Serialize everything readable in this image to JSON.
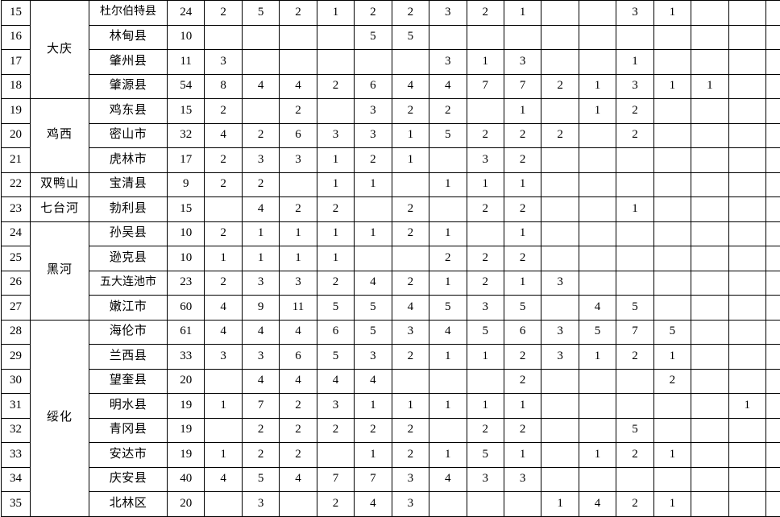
{
  "table": {
    "columns": {
      "index_header": "",
      "region_header": "",
      "county_header": "",
      "data_column_count": 17
    },
    "rows": [
      {
        "index": "15",
        "region": "大庆",
        "region_rowspan": 4,
        "county": "杜尔伯特县",
        "values": [
          "24",
          "2",
          "5",
          "2",
          "1",
          "2",
          "2",
          "3",
          "2",
          "1",
          "",
          "",
          "3",
          "1",
          "",
          "",
          ""
        ]
      },
      {
        "index": "16",
        "region": "",
        "county": "林甸县",
        "values": [
          "10",
          "",
          "",
          "",
          "",
          "5",
          "5",
          "",
          "",
          "",
          "",
          "",
          "",
          "",
          "",
          "",
          ""
        ]
      },
      {
        "index": "17",
        "region": "",
        "county": "肇州县",
        "values": [
          "11",
          "3",
          "",
          "",
          "",
          "",
          "",
          "3",
          "1",
          "3",
          "",
          "",
          "1",
          "",
          "",
          "",
          ""
        ]
      },
      {
        "index": "18",
        "region": "",
        "county": "肇源县",
        "values": [
          "54",
          "8",
          "4",
          "4",
          "2",
          "6",
          "4",
          "4",
          "7",
          "7",
          "2",
          "1",
          "3",
          "1",
          "1",
          "",
          ""
        ]
      },
      {
        "index": "19",
        "region": "鸡西",
        "region_rowspan": 3,
        "county": "鸡东县",
        "values": [
          "15",
          "2",
          "",
          "2",
          "",
          "3",
          "2",
          "2",
          "",
          "1",
          "",
          "1",
          "2",
          "",
          "",
          "",
          ""
        ]
      },
      {
        "index": "20",
        "region": "",
        "county": "密山市",
        "values": [
          "32",
          "4",
          "2",
          "6",
          "3",
          "3",
          "1",
          "5",
          "2",
          "2",
          "2",
          "",
          "2",
          "",
          "",
          "",
          ""
        ]
      },
      {
        "index": "21",
        "region": "",
        "county": "虎林市",
        "values": [
          "17",
          "2",
          "3",
          "3",
          "1",
          "2",
          "1",
          "",
          "3",
          "2",
          "",
          "",
          "",
          "",
          "",
          "",
          ""
        ]
      },
      {
        "index": "22",
        "region": "双鸭山",
        "region_rowspan": 1,
        "county": "宝清县",
        "values": [
          "9",
          "2",
          "2",
          "",
          "1",
          "1",
          "",
          "1",
          "1",
          "1",
          "",
          "",
          "",
          "",
          "",
          "",
          ""
        ]
      },
      {
        "index": "23",
        "region": "七台河",
        "region_rowspan": 1,
        "county": "勃利县",
        "values": [
          "15",
          "",
          "4",
          "2",
          "2",
          "",
          "2",
          "",
          "2",
          "2",
          "",
          "",
          "1",
          "",
          "",
          "",
          ""
        ]
      },
      {
        "index": "24",
        "region": "黑河",
        "region_rowspan": 4,
        "county": "孙吴县",
        "values": [
          "10",
          "2",
          "1",
          "1",
          "1",
          "1",
          "2",
          "1",
          "",
          "1",
          "",
          "",
          "",
          "",
          "",
          "",
          ""
        ]
      },
      {
        "index": "25",
        "region": "",
        "county": "逊克县",
        "values": [
          "10",
          "1",
          "1",
          "1",
          "1",
          "",
          "",
          "2",
          "2",
          "2",
          "",
          "",
          "",
          "",
          "",
          "",
          ""
        ]
      },
      {
        "index": "26",
        "region": "",
        "county": "五大连池市",
        "values": [
          "23",
          "2",
          "3",
          "3",
          "2",
          "4",
          "2",
          "1",
          "2",
          "1",
          "3",
          "",
          "",
          "",
          "",
          "",
          ""
        ]
      },
      {
        "index": "27",
        "region": "",
        "county": "嫩江市",
        "values": [
          "60",
          "4",
          "9",
          "11",
          "5",
          "5",
          "4",
          "5",
          "3",
          "5",
          "",
          "4",
          "5",
          "",
          "",
          "",
          ""
        ]
      },
      {
        "index": "28",
        "region": "绥化",
        "region_rowspan": 8,
        "county": "海伦市",
        "values": [
          "61",
          "4",
          "4",
          "4",
          "6",
          "5",
          "3",
          "4",
          "5",
          "6",
          "3",
          "5",
          "7",
          "5",
          "",
          "",
          ""
        ]
      },
      {
        "index": "29",
        "region": "",
        "county": "兰西县",
        "values": [
          "33",
          "3",
          "3",
          "6",
          "5",
          "3",
          "2",
          "1",
          "1",
          "2",
          "3",
          "1",
          "2",
          "1",
          "",
          "",
          ""
        ]
      },
      {
        "index": "30",
        "region": "",
        "county": "望奎县",
        "values": [
          "20",
          "",
          "4",
          "4",
          "4",
          "4",
          "",
          "",
          "",
          "2",
          "",
          "",
          "",
          "2",
          "",
          "",
          ""
        ]
      },
      {
        "index": "31",
        "region": "",
        "county": "明水县",
        "values": [
          "19",
          "1",
          "7",
          "2",
          "3",
          "1",
          "1",
          "1",
          "1",
          "1",
          "",
          "",
          "",
          "",
          "",
          "1",
          ""
        ]
      },
      {
        "index": "32",
        "region": "",
        "county": "青冈县",
        "values": [
          "19",
          "",
          "2",
          "2",
          "2",
          "2",
          "2",
          "",
          "2",
          "2",
          "",
          "",
          "5",
          "",
          "",
          "",
          ""
        ]
      },
      {
        "index": "33",
        "region": "",
        "county": "安达市",
        "values": [
          "19",
          "1",
          "2",
          "2",
          "",
          "1",
          "2",
          "1",
          "5",
          "1",
          "",
          "1",
          "2",
          "1",
          "",
          "",
          ""
        ]
      },
      {
        "index": "34",
        "region": "",
        "county": "庆安县",
        "values": [
          "40",
          "4",
          "5",
          "4",
          "7",
          "7",
          "3",
          "4",
          "3",
          "3",
          "",
          "",
          "",
          "",
          "",
          "",
          ""
        ]
      },
      {
        "index": "35",
        "region": "",
        "county": "北林区",
        "values": [
          "20",
          "",
          "3",
          "",
          "2",
          "4",
          "3",
          "",
          "",
          "",
          "1",
          "4",
          "2",
          "1",
          "",
          "",
          ""
        ]
      }
    ]
  },
  "style": {
    "border_color": "#000000",
    "background": "#ffffff",
    "text_color": "#000000"
  }
}
